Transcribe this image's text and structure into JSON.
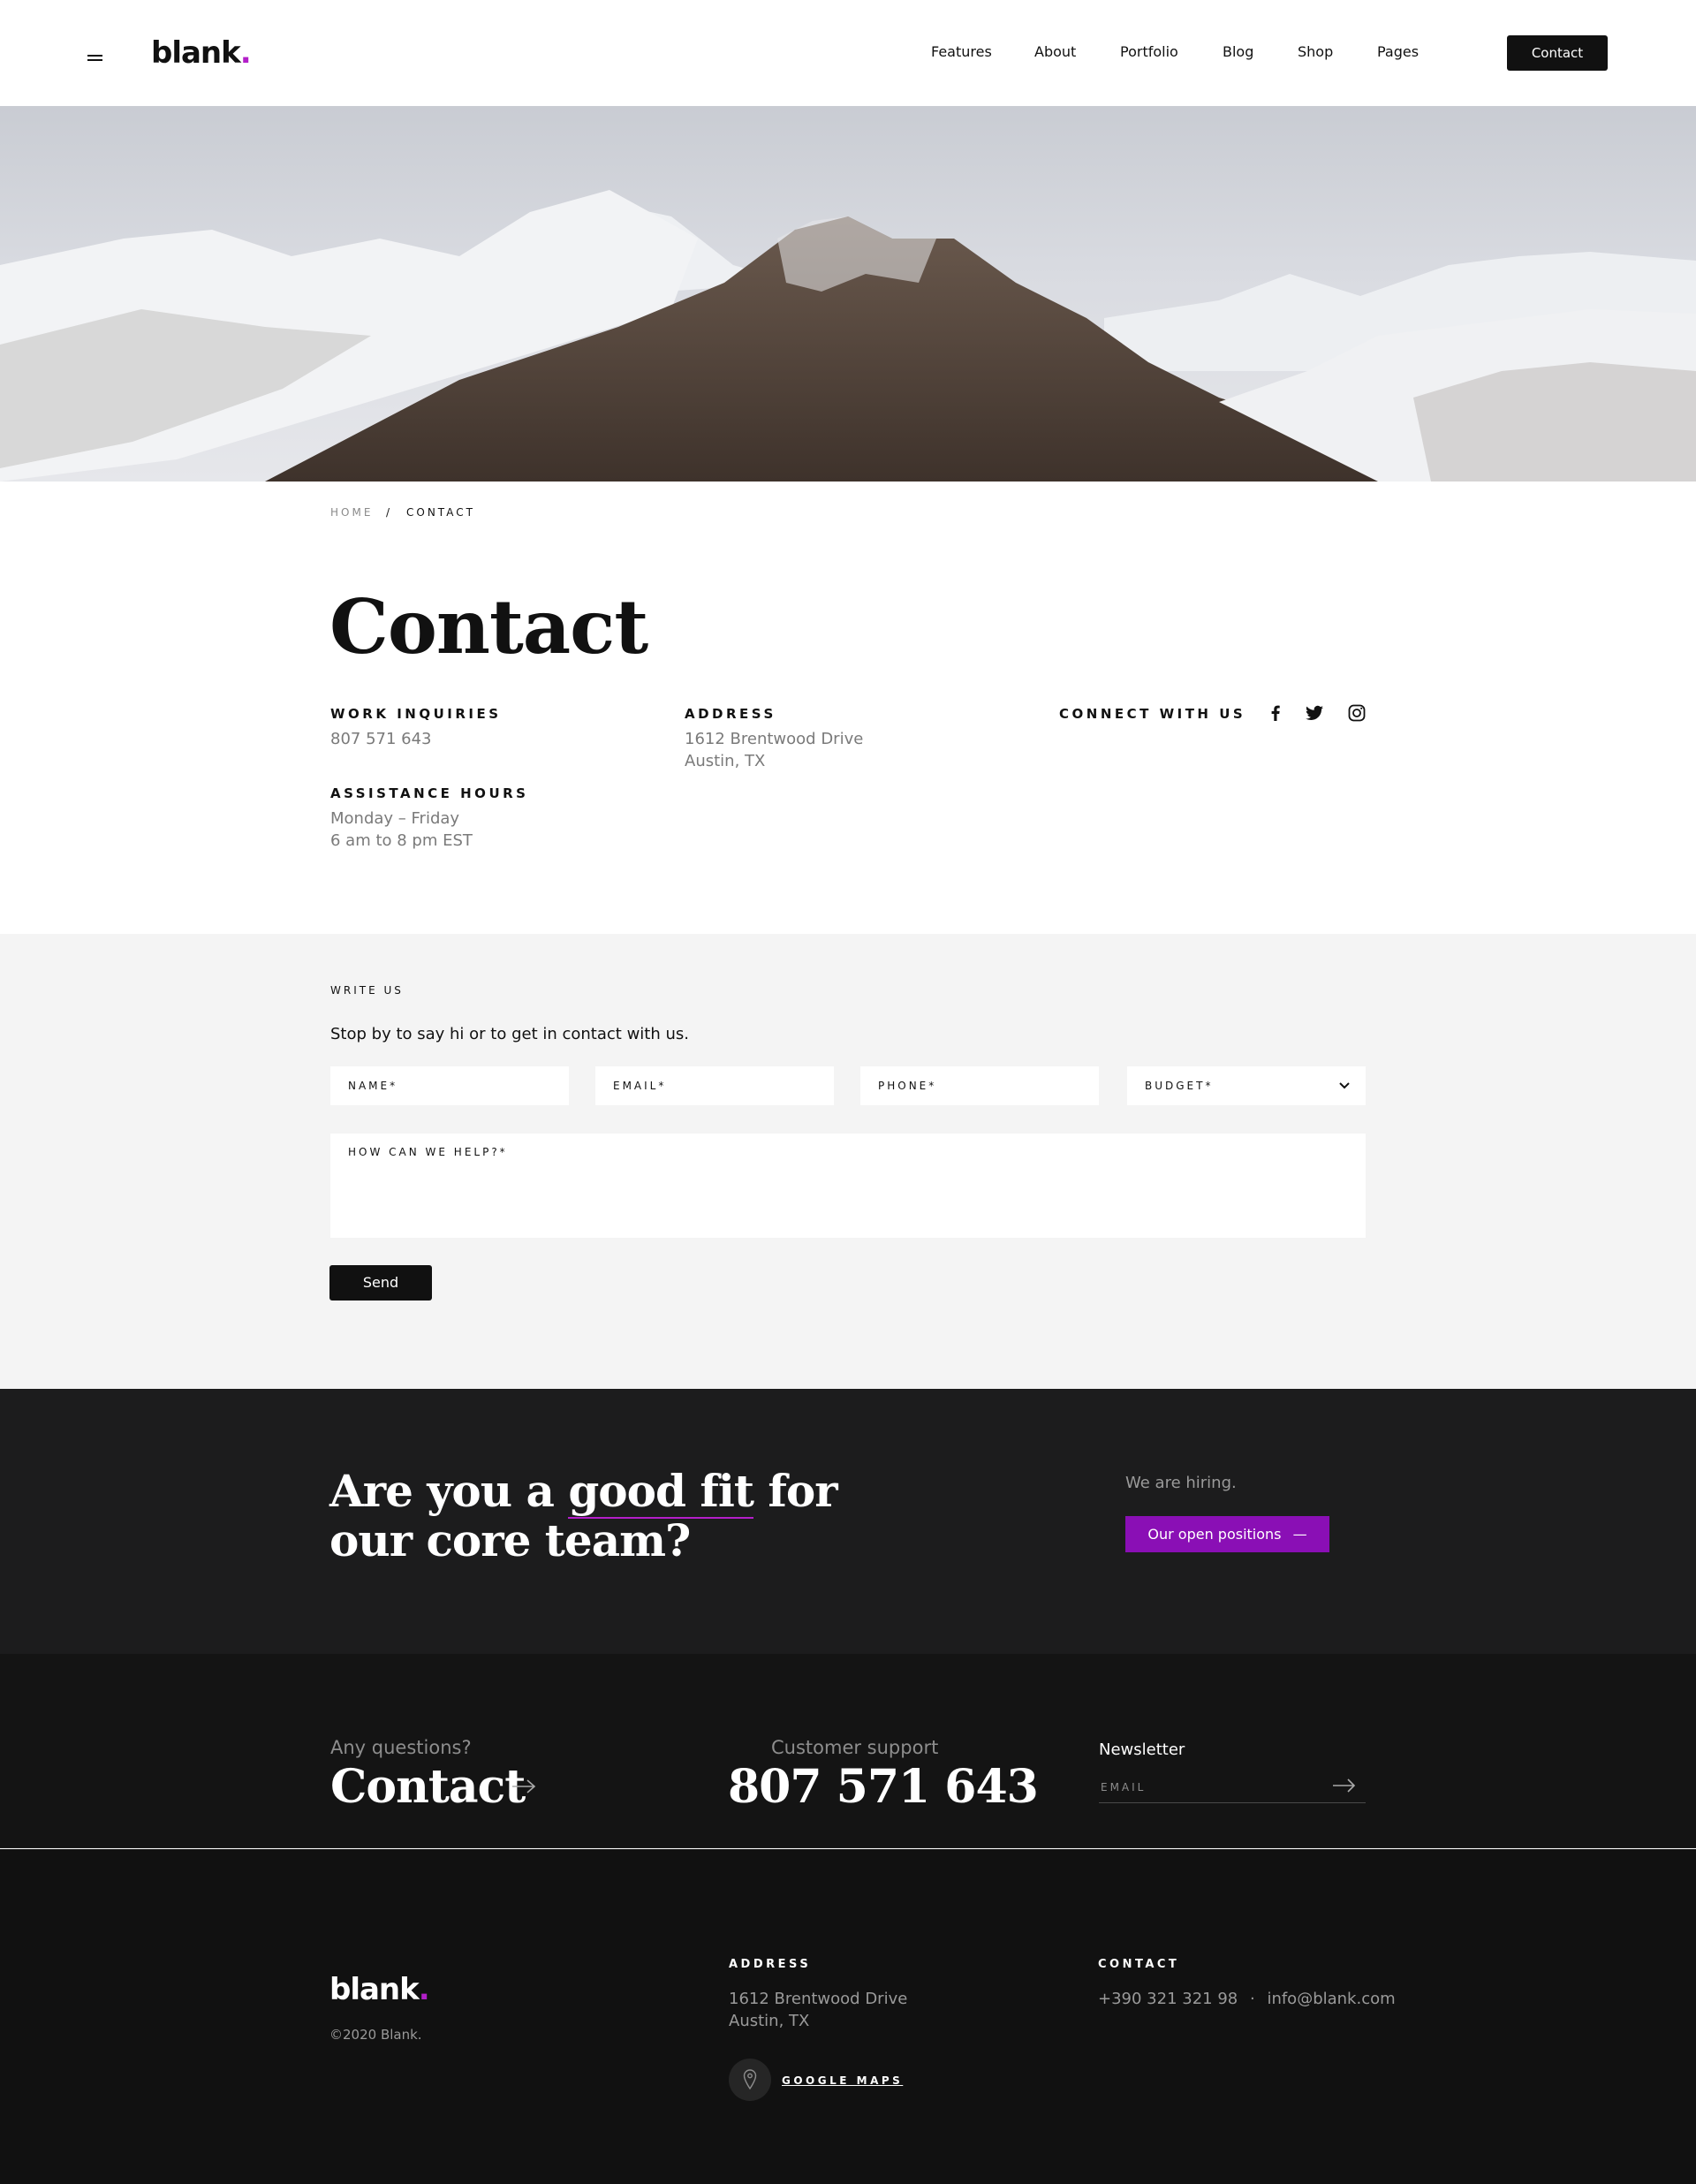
{
  "header": {
    "logo_text": "blank",
    "logo_dot": ".",
    "nav": [
      "Features",
      "About",
      "Portfolio",
      "Blog",
      "Shop",
      "Pages"
    ],
    "cta_label": "Contact"
  },
  "breadcrumb": {
    "home": "HOME",
    "separator": "/",
    "current": "CONTACT"
  },
  "contact": {
    "title": "Contact",
    "work_label": "WORK INQUIRIES",
    "work_value": "807 571 643",
    "address_label": "ADDRESS",
    "address_line1": "1612 Brentwood Drive",
    "address_line2": "Austin, TX",
    "connect_label": "CONNECT WITH US",
    "hours_label": "ASSISTANCE HOURS",
    "hours_line1": "Monday – Friday",
    "hours_line2": "6 am to 8 pm EST",
    "social_icons": [
      "facebook-icon",
      "twitter-icon",
      "instagram-icon"
    ]
  },
  "write": {
    "label": "WRITE US",
    "intro": "Stop by to say hi or to get in contact with us.",
    "name_placeholder": "NAME*",
    "email_placeholder": "EMAIL*",
    "phone_placeholder": "PHONE*",
    "budget_placeholder": "BUDGET*",
    "message_placeholder": "HOW CAN WE HELP?*",
    "send_label": "Send"
  },
  "hiring": {
    "title_pre": "Are you a ",
    "title_highlight": "good fit",
    "title_post": " for",
    "title_line2": "our core team?",
    "note": "We are hiring.",
    "button_label": "Our open positions",
    "button_suffix": "—"
  },
  "strip": {
    "questions_label": "Any questions?",
    "questions_link": "Contact",
    "support_label": "Customer support",
    "support_number": "807 571 643",
    "newsletter_label": "Newsletter",
    "newsletter_placeholder": "EMAIL"
  },
  "footer": {
    "logo_text": "blank",
    "logo_dot": ".",
    "copyright": "©2020 Blank.",
    "address_label": "ADDRESS",
    "address_line1": "1612  Brentwood Drive",
    "address_line2": "Austin, TX",
    "maps_label": "GOOGLE MAPS",
    "contact_label": "CONTACT",
    "phone": "+390 321 321 98",
    "separator": "·",
    "email": "info@blank.com"
  },
  "colors": {
    "accent": "#b31fc9",
    "button_purple": "#8a0fb5",
    "dark": "#111111"
  }
}
